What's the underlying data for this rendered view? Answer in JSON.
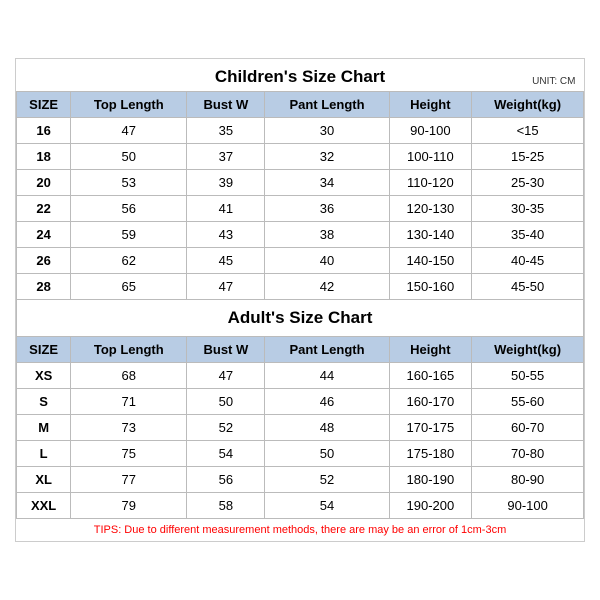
{
  "children_title": "Children's Size Chart",
  "adult_title": "Adult's Size Chart",
  "unit": "UNIT: CM",
  "children_headers": [
    "SIZE",
    "Top Length",
    "Bust W",
    "Pant Length",
    "Height",
    "Weight(kg)"
  ],
  "children_rows": [
    [
      "16",
      "47",
      "35",
      "30",
      "90-100",
      "<15"
    ],
    [
      "18",
      "50",
      "37",
      "32",
      "100-110",
      "15-25"
    ],
    [
      "20",
      "53",
      "39",
      "34",
      "110-120",
      "25-30"
    ],
    [
      "22",
      "56",
      "41",
      "36",
      "120-130",
      "30-35"
    ],
    [
      "24",
      "59",
      "43",
      "38",
      "130-140",
      "35-40"
    ],
    [
      "26",
      "62",
      "45",
      "40",
      "140-150",
      "40-45"
    ],
    [
      "28",
      "65",
      "47",
      "42",
      "150-160",
      "45-50"
    ]
  ],
  "adult_headers": [
    "SIZE",
    "Top Length",
    "Bust W",
    "Pant Length",
    "Height",
    "Weight(kg)"
  ],
  "adult_rows": [
    [
      "XS",
      "68",
      "47",
      "44",
      "160-165",
      "50-55"
    ],
    [
      "S",
      "71",
      "50",
      "46",
      "160-170",
      "55-60"
    ],
    [
      "M",
      "73",
      "52",
      "48",
      "170-175",
      "60-70"
    ],
    [
      "L",
      "75",
      "54",
      "50",
      "175-180",
      "70-80"
    ],
    [
      "XL",
      "77",
      "56",
      "52",
      "180-190",
      "80-90"
    ],
    [
      "XXL",
      "79",
      "58",
      "54",
      "190-200",
      "90-100"
    ]
  ],
  "tips": "TIPS: Due to different measurement methods, there are may be an error of 1cm-3cm"
}
